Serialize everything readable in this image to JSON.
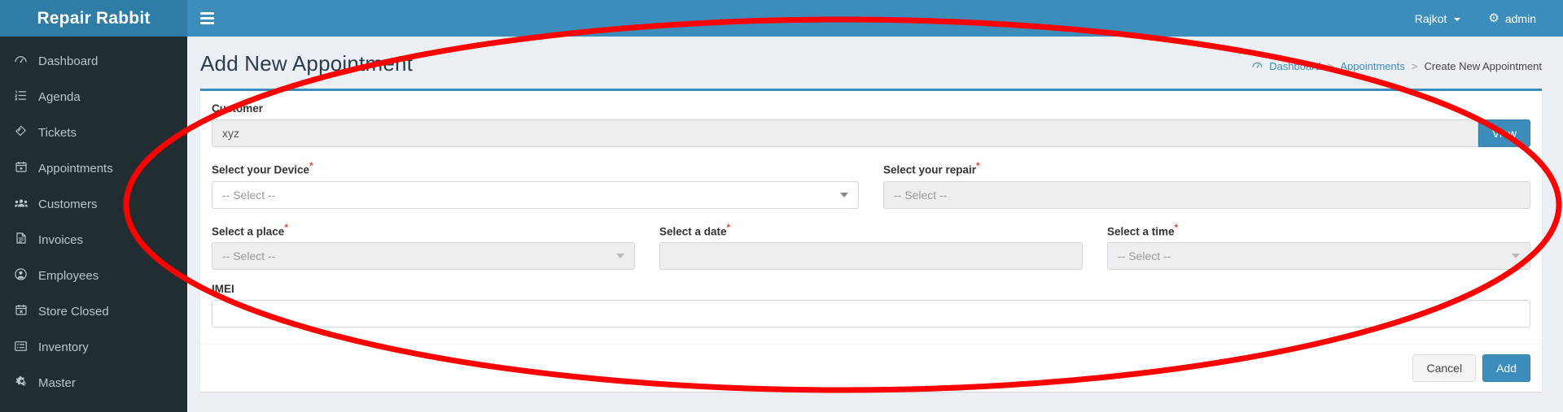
{
  "brand": {
    "title": "Repair Rabbit"
  },
  "topnav": {
    "menu_toggle_icon": "hamburger-icon",
    "location_label": "Rajkot",
    "user_label": "admin",
    "user_icon": "gear-icon"
  },
  "sidebar": {
    "items": [
      {
        "label": "Dashboard",
        "icon": "dashboard-icon"
      },
      {
        "label": "Agenda",
        "icon": "list-ol-icon"
      },
      {
        "label": "Tickets",
        "icon": "ticket-icon"
      },
      {
        "label": "Appointments",
        "icon": "calendar-plus-icon"
      },
      {
        "label": "Customers",
        "icon": "users-icon"
      },
      {
        "label": "Invoices",
        "icon": "file-text-icon"
      },
      {
        "label": "Employees",
        "icon": "user-circle-icon"
      },
      {
        "label": "Store Closed",
        "icon": "calendar-times-icon"
      },
      {
        "label": "Inventory",
        "icon": "list-alt-icon"
      },
      {
        "label": "Master",
        "icon": "cogs-icon"
      }
    ]
  },
  "page": {
    "title": "Add New Appointment",
    "breadcrumb": {
      "home_icon": "dashboard-icon",
      "items": [
        "Dashboard",
        "Appointments",
        "Create New Appointment"
      ],
      "separator": ">"
    }
  },
  "form": {
    "customer": {
      "label": "Customer",
      "value": "xyz",
      "view_button": "View"
    },
    "device": {
      "label": "Select your Device",
      "required_mark": "*",
      "value": "-- Select --"
    },
    "repair": {
      "label": "Select your repair",
      "required_mark": "*",
      "value": "-- Select --"
    },
    "place": {
      "label": "Select a place",
      "required_mark": "*",
      "value": "-- Select --"
    },
    "date": {
      "label": "Select a date",
      "required_mark": "*",
      "value": ""
    },
    "time": {
      "label": "Select a time",
      "required_mark": "*",
      "value": "-- Select --"
    },
    "imei": {
      "label": "IMEI",
      "value": ""
    },
    "cancel_button": "Cancel",
    "add_button": "Add"
  },
  "colors": {
    "brand_blue": "#3c8dbc",
    "brand_blue_dark": "#2f7ca6",
    "sidebar_dark": "#222d32",
    "page_bg": "#ecf0f5",
    "annotation_red": "#ff0000",
    "required_red": "#dd4b39"
  }
}
